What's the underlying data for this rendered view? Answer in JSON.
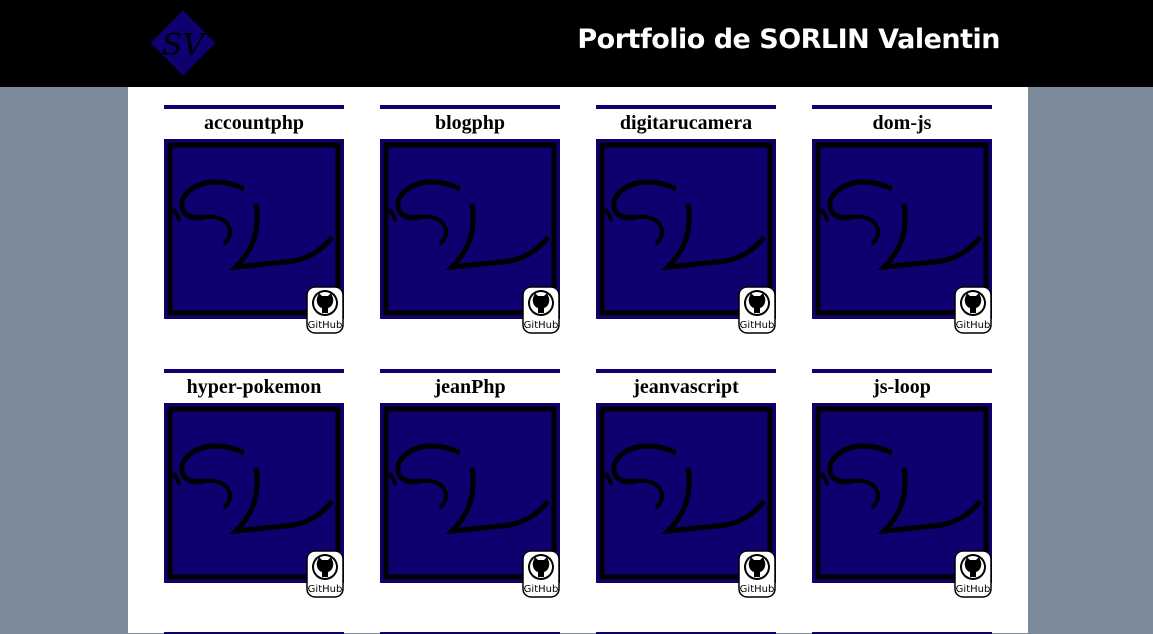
{
  "header": {
    "logo_text": "SV",
    "title": "Portfolio de SORLIN Valentin"
  },
  "projects": [
    {
      "name": "accountphp",
      "github_label": "GitHub"
    },
    {
      "name": "blogphp",
      "github_label": "GitHub"
    },
    {
      "name": "digitarucamera",
      "github_label": "GitHub"
    },
    {
      "name": "dom-js",
      "github_label": "GitHub"
    },
    {
      "name": "hyper-pokemon",
      "github_label": "GitHub"
    },
    {
      "name": "jeanPhp",
      "github_label": "GitHub"
    },
    {
      "name": "jeanvascript",
      "github_label": "GitHub"
    },
    {
      "name": "js-loop",
      "github_label": "GitHub"
    }
  ],
  "thumbnail_mark": "SV",
  "colors": {
    "header_bg": "#000000",
    "page_bg": "#7a8a99",
    "accent": "#0e006e"
  }
}
